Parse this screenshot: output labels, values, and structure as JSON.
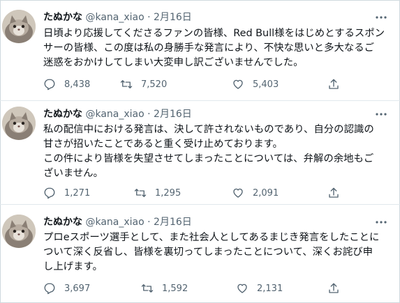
{
  "tweets": [
    {
      "name": "たぬかな",
      "handle": "@kana_xiao",
      "dot": "·",
      "date": "2月16日",
      "lines": [
        "日頃より応援してくださるファンの皆様、Red Bull様をはじめとするスポン",
        "サーの皆様、この度は私の身勝手な発言により、不快な思いと多大なるご",
        "迷惑をおかけしてしまい大変申し訳ございませんでした。"
      ],
      "replies": "8,438",
      "retweets": "7,520",
      "likes": "5,403"
    },
    {
      "name": "たぬかな",
      "handle": "@kana_xiao",
      "dot": "·",
      "date": "2月16日",
      "lines": [
        "私の配信中における発言は、決して許されないものであり、自分の認識の",
        "甘さが招いたことであると重く受け止めております。",
        "この件により皆様を失望させてしまったことについては、弁解の余地もご",
        "ざいません。"
      ],
      "replies": "1,271",
      "retweets": "1,295",
      "likes": "2,091"
    },
    {
      "name": "たぬかな",
      "handle": "@kana_xiao",
      "dot": "·",
      "date": "2月16日",
      "lines": [
        "プロeスポーツ選手として、また社会人としてあるまじき発言をしたことに",
        "ついて深く反省し、皆様を裏切ってしまったことについて、深くお詫び申",
        "し上げます。"
      ],
      "replies": "3,697",
      "retweets": "1,592",
      "likes": "2,131"
    }
  ],
  "icons": {
    "reply": "reply-icon",
    "retweet": "retweet-icon",
    "like": "heart-icon",
    "share": "share-icon",
    "more": "more-icon",
    "avatar": "cat-avatar"
  },
  "colors": {
    "text": "#0f1419",
    "secondary": "#536471",
    "divider": "#e1e8ed"
  }
}
